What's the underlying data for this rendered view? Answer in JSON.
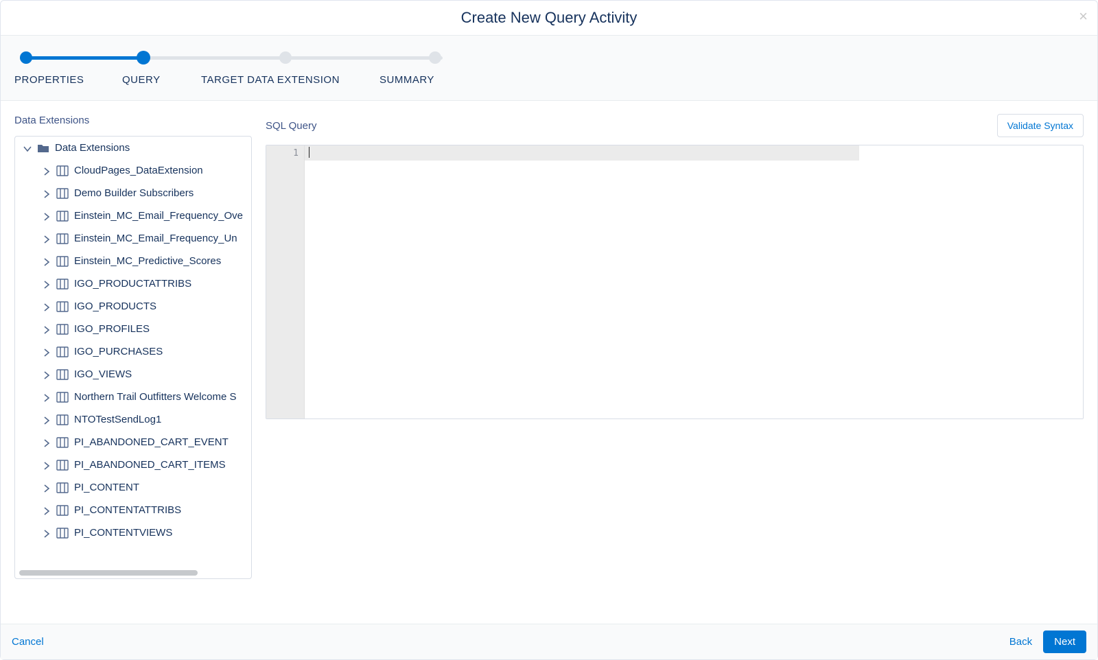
{
  "modal": {
    "title": "Create New Query Activity"
  },
  "steps": {
    "step1": "PROPERTIES",
    "step2": "QUERY",
    "step3": "TARGET DATA EXTENSION",
    "step4": "SUMMARY"
  },
  "leftPane": {
    "heading": "Data Extensions",
    "rootLabel": "Data Extensions",
    "items": [
      {
        "label": "CloudPages_DataExtension"
      },
      {
        "label": "Demo Builder Subscribers"
      },
      {
        "label": "Einstein_MC_Email_Frequency_Ove"
      },
      {
        "label": "Einstein_MC_Email_Frequency_Un"
      },
      {
        "label": "Einstein_MC_Predictive_Scores"
      },
      {
        "label": "IGO_PRODUCTATTRIBS"
      },
      {
        "label": "IGO_PRODUCTS"
      },
      {
        "label": "IGO_PROFILES"
      },
      {
        "label": "IGO_PURCHASES"
      },
      {
        "label": "IGO_VIEWS"
      },
      {
        "label": "Northern Trail Outfitters Welcome S"
      },
      {
        "label": "NTOTestSendLog1"
      },
      {
        "label": "PI_ABANDONED_CART_EVENT"
      },
      {
        "label": "PI_ABANDONED_CART_ITEMS"
      },
      {
        "label": "PI_CONTENT"
      },
      {
        "label": "PI_CONTENTATTRIBS"
      },
      {
        "label": "PI_CONTENTVIEWS"
      }
    ]
  },
  "rightPane": {
    "heading": "SQL Query",
    "validateLabel": "Validate Syntax",
    "lineNumber": "1"
  },
  "footer": {
    "cancel": "Cancel",
    "back": "Back",
    "next": "Next"
  }
}
